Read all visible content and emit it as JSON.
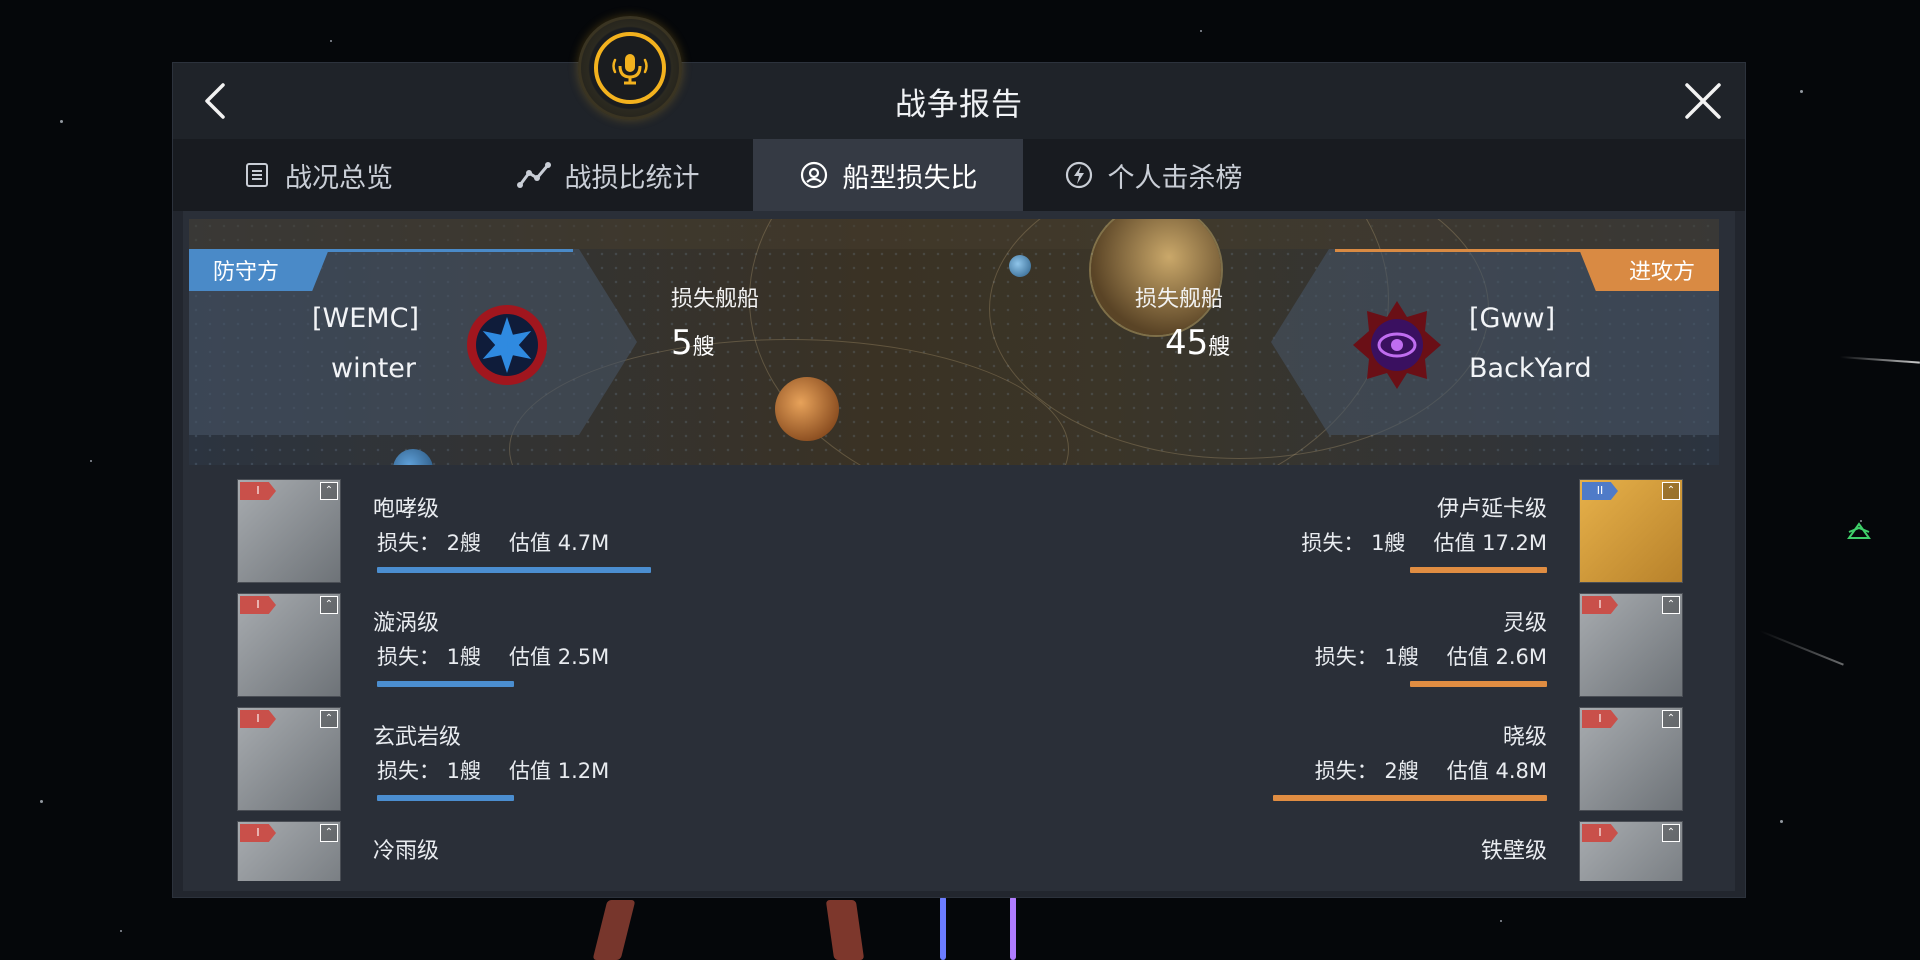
{
  "window": {
    "title": "战争报告"
  },
  "tabs": [
    {
      "label": "战况总览",
      "icon": "list-icon"
    },
    {
      "label": "战损比统计",
      "icon": "trend-icon"
    },
    {
      "label": "船型损失比",
      "icon": "ship-ratio-icon",
      "active": true
    },
    {
      "label": "个人击杀榜",
      "icon": "lightning-icon"
    }
  ],
  "defender": {
    "tag": "防守方",
    "corp": "[WEMC]",
    "pilot": "winter",
    "loss_label": "损失舰船",
    "loss_count": "5",
    "loss_unit": "艘",
    "color": "#4a8ac8"
  },
  "attacker": {
    "tag": "进攻方",
    "corp": "[Gww]",
    "pilot": "BackYard",
    "loss_label": "损失舰船",
    "loss_count": "45",
    "loss_unit": "艘",
    "color": "#d98a43"
  },
  "defender_ships": [
    {
      "name": "咆哮级",
      "loss": "损失： 2艘",
      "value": "估值 4.7M",
      "tier": "I",
      "bar_fraction": 1.0
    },
    {
      "name": "漩涡级",
      "loss": "损失： 1艘",
      "value": "估值 2.5M",
      "tier": "I",
      "bar_fraction": 0.5
    },
    {
      "name": "玄武岩级",
      "loss": "损失： 1艘",
      "value": "估值 1.2M",
      "tier": "I",
      "bar_fraction": 0.5
    },
    {
      "name": "冷雨级",
      "loss": "",
      "value": "",
      "tier": "I",
      "bar_fraction": 0
    }
  ],
  "attacker_ships": [
    {
      "name": "伊卢延卡级",
      "loss": "损失： 1艘",
      "value": "估值 17.2M",
      "tier": "II",
      "bar_fraction": 0.5
    },
    {
      "name": "灵级",
      "loss": "损失： 1艘",
      "value": "估值 2.6M",
      "tier": "I",
      "bar_fraction": 0.5
    },
    {
      "name": "晓级",
      "loss": "损失： 2艘",
      "value": "估值 4.8M",
      "tier": "I",
      "bar_fraction": 1.0
    },
    {
      "name": "铁壁级",
      "loss": "",
      "value": "",
      "tier": "I",
      "bar_fraction": 0
    }
  ],
  "colors": {
    "accent_mic": "#f3b21e",
    "bar_defender": "#4b8ed0",
    "bar_attacker": "#e08d42"
  }
}
